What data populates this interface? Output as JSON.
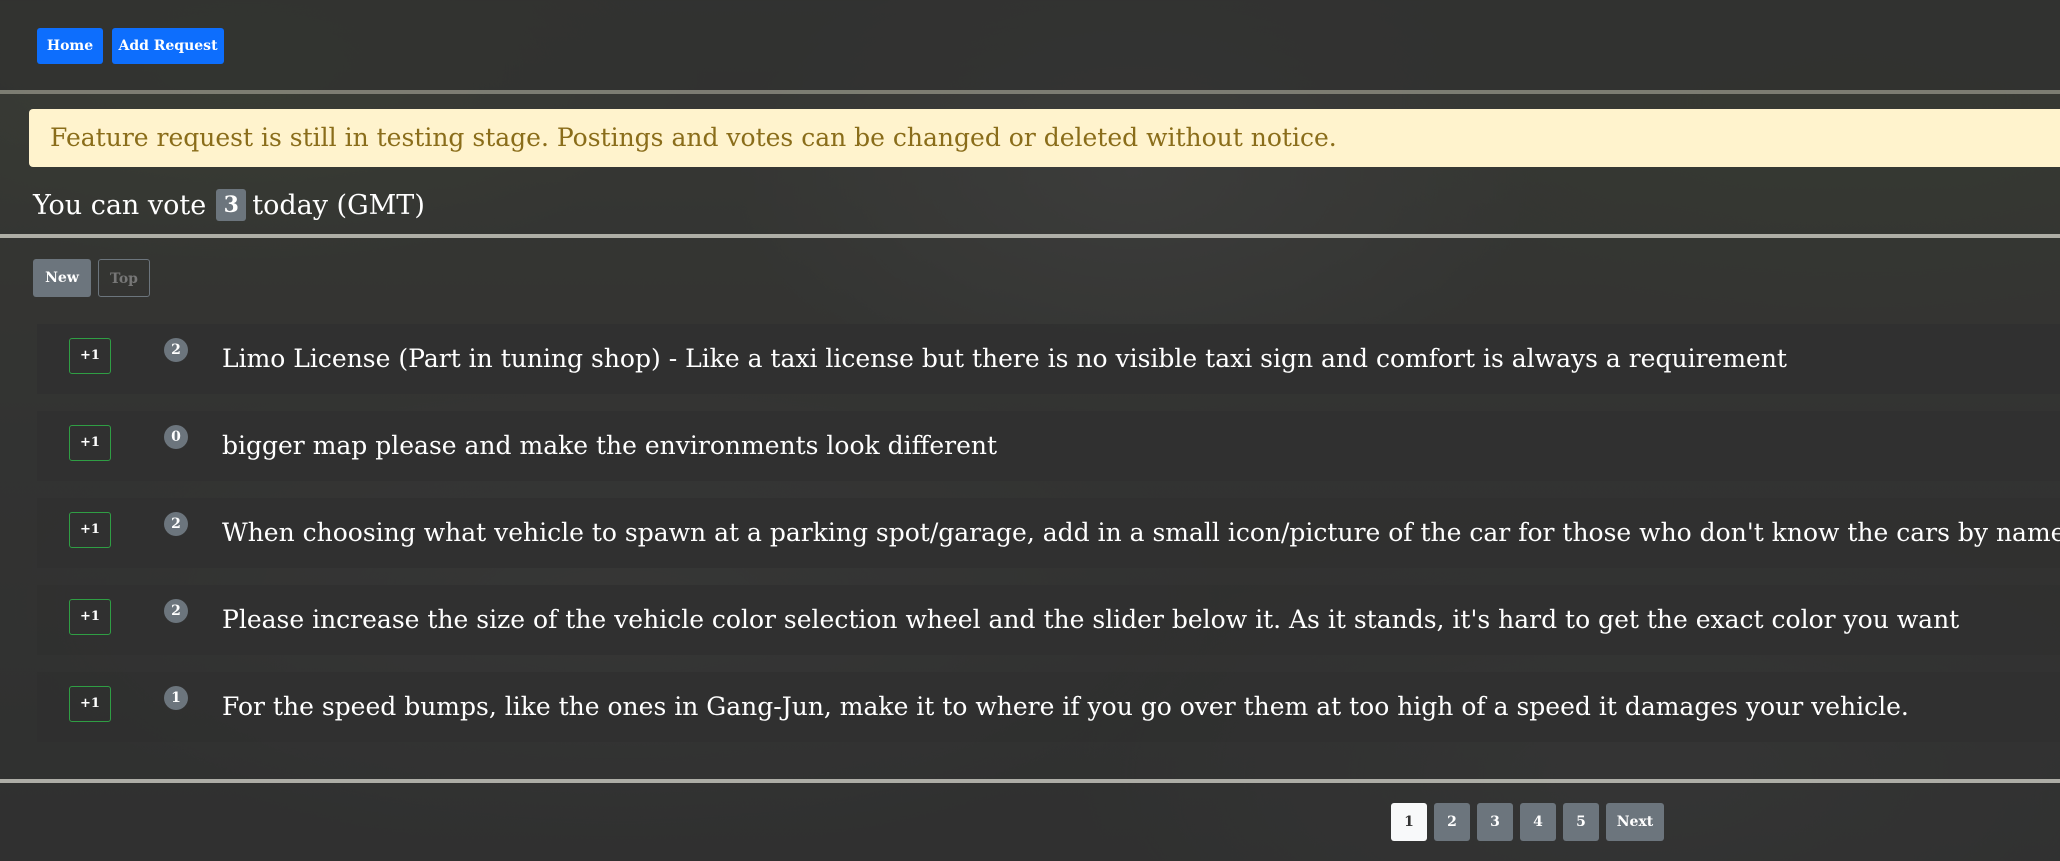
{
  "nav": {
    "home_label": "Home",
    "add_request_label": "Add Request"
  },
  "alert": {
    "text": "Feature request is still in testing stage. Postings and votes can be changed or deleted without notice."
  },
  "votes": {
    "prefix": "You can vote",
    "count": "3",
    "suffix": "today (GMT)"
  },
  "sort": {
    "new_label": "New",
    "top_label": "Top",
    "active": "New"
  },
  "requests": [
    {
      "button": "+1",
      "votes": "2",
      "text": "Limo License (Part in tuning shop) - Like a taxi license but there is no visible taxi sign and comfort is always a requirement"
    },
    {
      "button": "+1",
      "votes": "0",
      "text": "bigger map please and make the environments look different"
    },
    {
      "button": "+1",
      "votes": "2",
      "text": "When choosing what vehicle to spawn at a parking spot/garage, add in a small icon/picture of the car for those who don't know the cars by name"
    },
    {
      "button": "+1",
      "votes": "2",
      "text": "Please increase the size of the vehicle color selection wheel and the slider below it. As it stands, it's hard to get the exact color you want"
    },
    {
      "button": "+1",
      "votes": "1",
      "text": "For the speed bumps, like the ones in Gang-Jun, make it to where if you go over them at too high of a speed it damages your vehicle."
    }
  ],
  "pagination": {
    "pages": [
      "1",
      "2",
      "3",
      "4",
      "5"
    ],
    "current": "1",
    "next_label": "Next"
  },
  "colors": {
    "primary": "#0d6efd",
    "secondary": "#6c757d",
    "alert_bg": "#fff3cd",
    "alert_text": "#8a6d1a",
    "vote_border": "#2f9e44"
  }
}
